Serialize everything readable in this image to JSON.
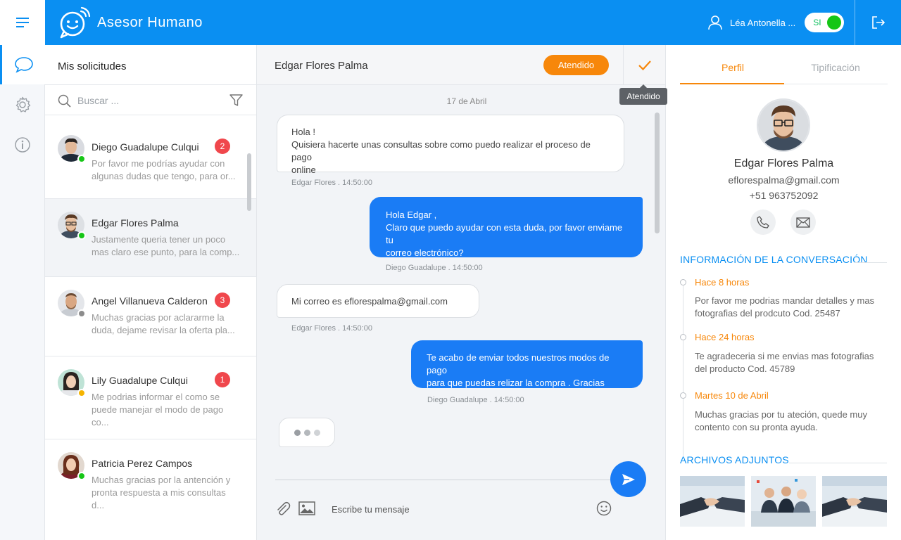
{
  "app": {
    "title": "Asesor Humano"
  },
  "user": {
    "name": "Léa Antonella ...",
    "status_label": "SI",
    "status_on": true
  },
  "colors": {
    "primary": "#0a8ff2",
    "accent": "#f7870a",
    "bubble_out": "#1a7cf5",
    "badge": "#f0474c",
    "online": "#16c616",
    "away": "#f5b400",
    "offline": "#8c8c8c"
  },
  "icons": {
    "menu": "menu-icon",
    "logo": "chat-logo-icon",
    "user": "user-icon",
    "logout": "logout-icon",
    "rail": [
      "chat-bubbles-icon",
      "gear-icon",
      "info-icon"
    ]
  },
  "sidebar": {
    "title": "Mis solicitudes",
    "search_placeholder": "Buscar ...",
    "conversations": [
      {
        "name": "Diego Guadalupe Culqui",
        "preview_line1": "Por favor me podrías ayudar con",
        "preview_line2": "algunas dudas que tengo, para or...",
        "badge": "2",
        "status": "online",
        "selected": false
      },
      {
        "name": "Edgar Flores Palma",
        "preview_line1": "Justamente queria tener un poco",
        "preview_line2": "mas claro ese punto, para la comp...",
        "badge": "",
        "status": "online",
        "selected": true
      },
      {
        "name": "Angel Villanueva Calderon",
        "preview_line1": "Muchas gracias por aclararme la",
        "preview_line2": "duda, dejame revisar la oferta pla...",
        "badge": "3",
        "status": "offline",
        "selected": false
      },
      {
        "name": "Lily Guadalupe Culqui",
        "preview_line1": "Me podrias informar el como se",
        "preview_line2": "puede manejar el modo de pago co...",
        "badge": "1",
        "status": "away",
        "selected": false
      },
      {
        "name": "Patricia Perez Campos",
        "preview_line1": "Muchas gracias por la antención y",
        "preview_line2": "pronta respuesta a mis consultas d...",
        "badge": "",
        "status": "online",
        "selected": false
      }
    ]
  },
  "chat": {
    "contact_name": "Edgar Flores Palma",
    "status_button": "Atendido",
    "tooltip": "Atendido",
    "date_separator": "17 de Abril",
    "messages": [
      {
        "direction": "in",
        "lines": [
          "Hola !",
          "Quisiera hacerte unas consultas sobre como puedo realizar el proceso de pago",
          "online"
        ],
        "meta": "Edgar Flores . 14:50:00"
      },
      {
        "direction": "out",
        "lines": [
          "Hola Edgar ,",
          "Claro que puedo ayudar con esta duda, por favor enviame tu",
          "correo electrónico?"
        ],
        "meta": "Diego Guadalupe . 14:50:00"
      },
      {
        "direction": "in",
        "lines": [
          "Mi correo es eflorespalma@gmail.com"
        ],
        "meta": "Edgar Flores . 14:50:00"
      },
      {
        "direction": "out",
        "lines": [
          "Te acabo de enviar todos nuestros modos de pago",
          "para que puedas relizar la compra . Gracias"
        ],
        "meta": "Diego Guadalupe . 14:50:00"
      }
    ],
    "input_placeholder": "Escribe tu mensaje"
  },
  "profile": {
    "tabs": [
      {
        "label": "Perfil",
        "active": true
      },
      {
        "label": "Tipificación",
        "active": false
      }
    ],
    "name": "Edgar Flores Palma",
    "email": "eflorespalma@gmail.com",
    "phone": "+51 963752092",
    "info_title": "INFORMACIÓN DE LA CONVERSACIÓN",
    "timeline": [
      {
        "time": "Hace 8 horas",
        "text_line1": "Por favor me podrias mandar detalles y mas",
        "text_line2": "fotografias del prodcuto Cod. 25487"
      },
      {
        "time": "Hace 24 horas",
        "text_line1": "Te agradeceria si me envias mas fotografias",
        "text_line2": "del producto Cod. 45789"
      },
      {
        "time": "Martes 10  de Abril",
        "text_line1": "Muchas gracias por tu ateción, quede muy",
        "text_line2": "contento con su pronta ayuda."
      }
    ],
    "attachments_title": "ARCHIVOS ADJUNTOS"
  }
}
